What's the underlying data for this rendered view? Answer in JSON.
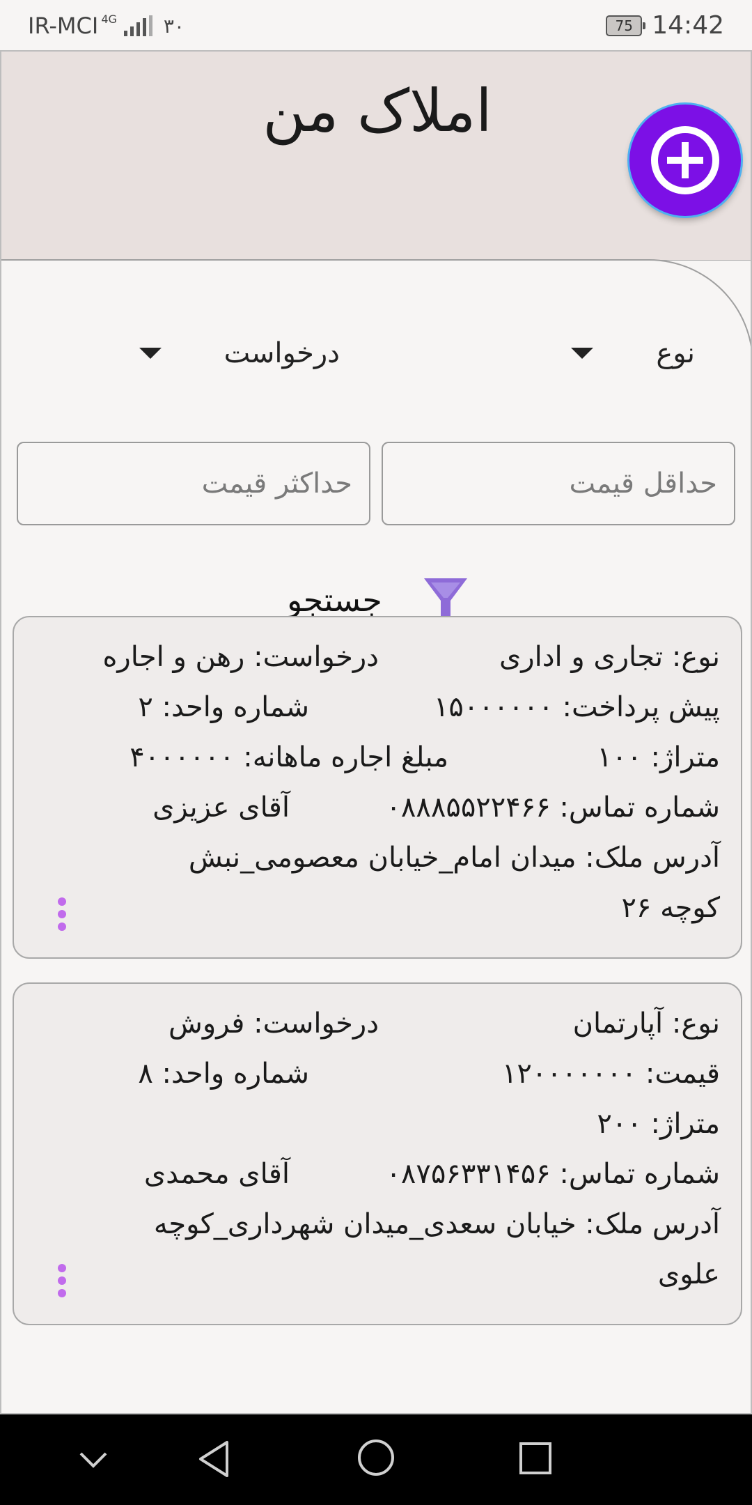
{
  "status_bar": {
    "carrier": "IR-MCI",
    "network": "4G",
    "notification": "۳۰",
    "battery": "75",
    "time": "14:42"
  },
  "header": {
    "title": "املاک من",
    "add_button_icon": "plus-circle-icon"
  },
  "filters": {
    "type_dropdown": "نوع",
    "request_dropdown": "درخواست",
    "min_price_placeholder": "حداقل قیمت",
    "max_price_placeholder": "حداکثر قیمت",
    "search_label": "جستجو"
  },
  "listings": [
    {
      "type": "نوع: تجاری و اداری",
      "request": "درخواست: رهن و اجاره",
      "price": "پیش پرداخت: ۱۵۰۰۰۰۰۰",
      "unit": "شماره واحد: ۲",
      "area": "متراژ: ۱۰۰",
      "rent": "مبلغ اجاره ماهانه: ۴۰۰۰۰۰۰",
      "phone": "شماره تماس: ۰۸۸۸۵۵۲۲۴۶۶",
      "owner": "آقای عزیزی",
      "address_line1": "آدرس ملک: میدان امام_خیابان معصومی_نبش",
      "address_line2": "کوچه ۲۶"
    },
    {
      "type": "نوع: آپارتمان",
      "request": "درخواست: فروش",
      "price": "قیمت: ۱۲۰۰۰۰۰۰۰",
      "unit": "شماره واحد: ۸",
      "area": "متراژ: ۲۰۰",
      "phone": "شماره تماس: ۰۸۷۵۶۳۳۱۴۵۶",
      "owner": "آقای محمدی",
      "address_line1": "آدرس ملک: خیابان سعدی_میدان شهرداری_کوچه",
      "address_line2": "علوی"
    }
  ],
  "colors": {
    "accent": "#7c10e6",
    "header_bg": "#e8e0de",
    "menu_dots": "#c16bec",
    "filter_icon": "#8e6bd8"
  }
}
